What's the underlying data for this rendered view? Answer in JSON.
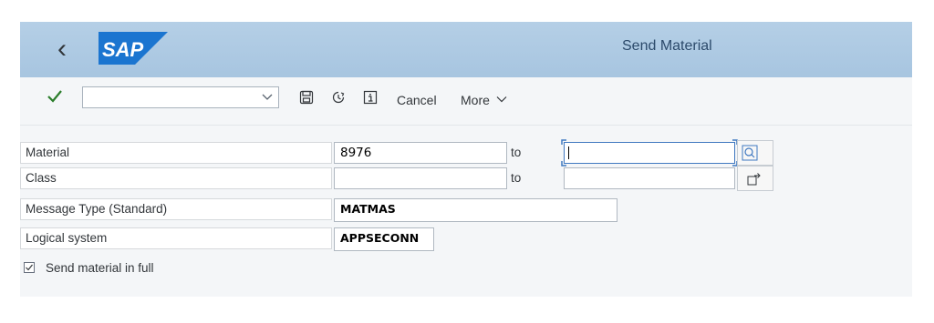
{
  "header": {
    "title": "Send Material",
    "logo_text": "SAP"
  },
  "toolbar": {
    "command_field_value": "",
    "cancel_label": "Cancel",
    "more_label": "More"
  },
  "form": {
    "material": {
      "label": "Material",
      "from": "8976",
      "to_label": "to",
      "to": ""
    },
    "class": {
      "label": "Class",
      "from": "",
      "to_label": "to",
      "to": ""
    },
    "message_type": {
      "label": "Message Type (Standard)",
      "value": "MATMAS"
    },
    "logical_system": {
      "label": "Logical system",
      "value": "APPSECONN"
    },
    "send_in_full": {
      "label": "Send material in full",
      "checked": true
    }
  },
  "colors": {
    "shell": "#a7c5e0",
    "accent_check": "#2b7d2b",
    "sap_blue": "#0a6ed1"
  }
}
